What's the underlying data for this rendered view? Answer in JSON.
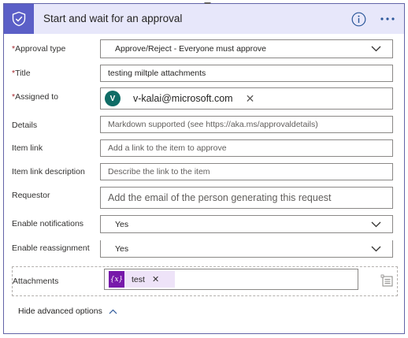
{
  "action": {
    "title": "Start and wait for an approval",
    "header_icon": "approval-check-icon",
    "info_icon": "info-icon",
    "more_icon": "more-options-icon"
  },
  "fields": {
    "approval_type": {
      "required_mark": "*",
      "label": "Approval type",
      "value": "Approve/Reject - Everyone must approve"
    },
    "title": {
      "required_mark": "*",
      "label": "Title",
      "value": "testing miltple attachments"
    },
    "assigned_to": {
      "required_mark": "*",
      "label": "Assigned to",
      "avatar_initial": "V",
      "value": "v-kalai@microsoft.com",
      "remove": "✕"
    },
    "details": {
      "label": "Details",
      "placeholder": "Markdown supported (see https://aka.ms/approvaldetails)"
    },
    "item_link": {
      "label": "Item link",
      "placeholder": "Add a link to the item to approve"
    },
    "item_link_description": {
      "label": "Item link description",
      "placeholder": "Describe the link to the item"
    },
    "requestor": {
      "label": "Requestor",
      "placeholder": "Add the email of the person generating this request"
    },
    "enable_notifications": {
      "label": "Enable notifications",
      "value": "Yes"
    },
    "enable_reassignment": {
      "label": "Enable reassignment",
      "value": "Yes"
    },
    "attachments": {
      "label": "Attachments",
      "token_label": "test",
      "token_remove": "✕",
      "token_icon": "expression-icon"
    }
  },
  "footer": {
    "hide_advanced_label": "Hide advanced options"
  },
  "colors": {
    "accent": "#5b5fc7",
    "header_bg": "#e7e7fa",
    "required": "#a4262c",
    "avatar": "#0f6c66",
    "token": "#7719aa"
  }
}
